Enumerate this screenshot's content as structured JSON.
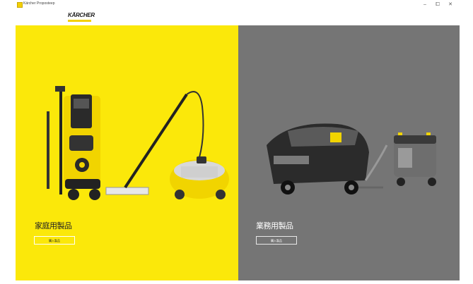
{
  "window": {
    "title": "Kärcher Proposteep",
    "controls": {
      "minimize": "–",
      "maximize": "⧠",
      "close": "✕"
    }
  },
  "header": {
    "logo_text": "KÄRCHER"
  },
  "panels": {
    "home": {
      "title": "家庭用製品",
      "button_label": "購入製品"
    },
    "pro": {
      "title": "業務用製品",
      "button_label": "購入製品"
    }
  },
  "colors": {
    "brand_yellow": "#fbe80a",
    "pro_gray": "#757575"
  }
}
